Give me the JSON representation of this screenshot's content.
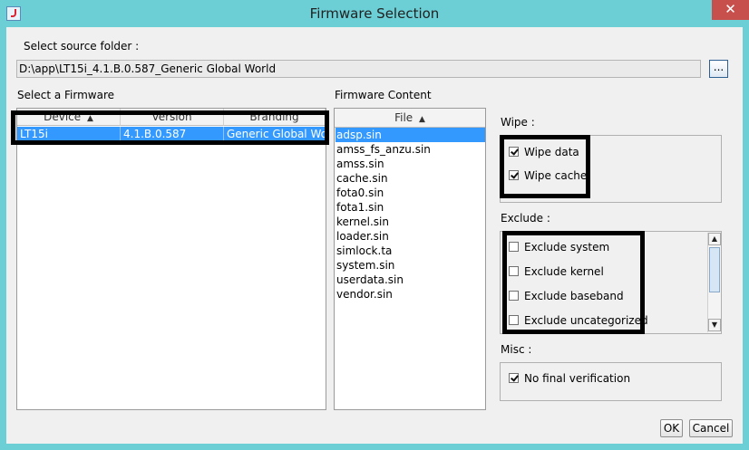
{
  "window": {
    "title": "Firmware Selection",
    "close_symbol": "✕"
  },
  "source": {
    "label": "Select source folder :",
    "path": "D:\\app\\LT15i_4.1.B.0.587_Generic Global World",
    "browse_label": "..."
  },
  "firmware_table": {
    "label": "Select a Firmware",
    "headers": [
      {
        "label": "Device",
        "sort": "▲"
      },
      {
        "label": "Version"
      },
      {
        "label": "Branding"
      }
    ],
    "rows": [
      {
        "device": "LT15i",
        "version": "4.1.B.0.587",
        "branding": "Generic Global Wo..."
      }
    ]
  },
  "content_list": {
    "label": "Firmware Content",
    "header": "File",
    "sort": "▲",
    "files": [
      "adsp.sin",
      "amss_fs_anzu.sin",
      "amss.sin",
      "cache.sin",
      "fota0.sin",
      "fota1.sin",
      "kernel.sin",
      "loader.sin",
      "simlock.ta",
      "system.sin",
      "userdata.sin",
      "vendor.sin"
    ],
    "selected_index": 0
  },
  "wipe": {
    "label": "Wipe :",
    "options": [
      {
        "label": "Wipe data",
        "checked": true
      },
      {
        "label": "Wipe cache",
        "checked": true
      }
    ]
  },
  "exclude": {
    "label": "Exclude :",
    "options": [
      {
        "label": "Exclude system",
        "checked": false
      },
      {
        "label": "Exclude kernel",
        "checked": false
      },
      {
        "label": "Exclude baseband",
        "checked": false
      },
      {
        "label": "Exclude uncategorized",
        "checked": false
      }
    ],
    "scroll_up": "▲",
    "scroll_down": "▼"
  },
  "misc": {
    "label": "Misc :",
    "options": [
      {
        "label": "No final verification",
        "checked": true
      }
    ]
  },
  "buttons": {
    "ok": "OK",
    "cancel": "Cancel"
  }
}
